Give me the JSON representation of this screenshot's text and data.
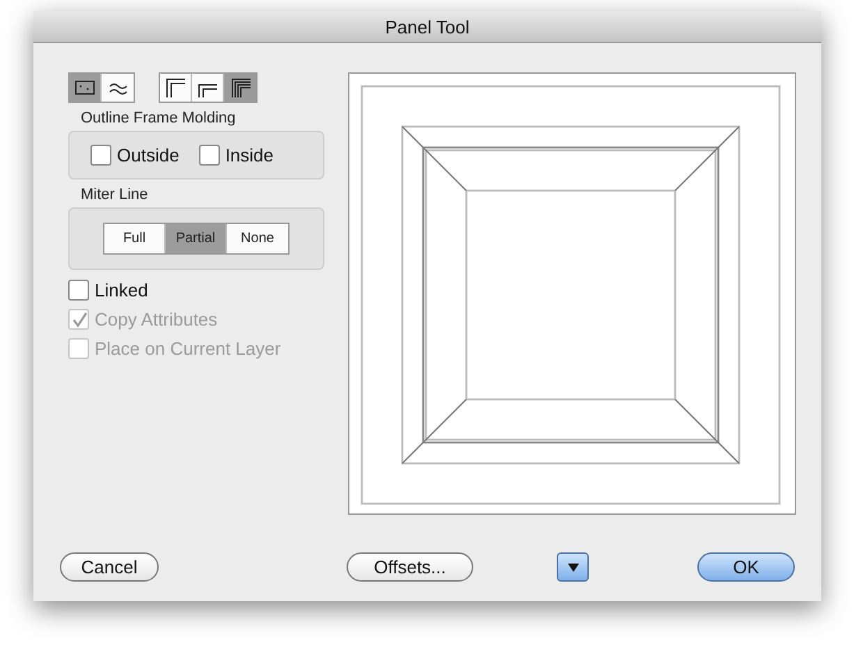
{
  "window": {
    "title": "Panel Tool"
  },
  "mode_buttons": [
    {
      "kind": "rectangle",
      "selected": true
    },
    {
      "kind": "wave",
      "selected": false
    }
  ],
  "corner_buttons": [
    {
      "kind": "wide",
      "selected": false
    },
    {
      "kind": "narrow",
      "selected": false
    },
    {
      "kind": "double",
      "selected": true
    }
  ],
  "outline_frame_molding": {
    "label": "Outline Frame Molding",
    "options": [
      {
        "label": "Outside",
        "checked": false
      },
      {
        "label": "Inside",
        "checked": false
      }
    ]
  },
  "miter_line": {
    "label": "Miter Line",
    "segments": [
      {
        "label": "Full",
        "selected": false
      },
      {
        "label": "Partial",
        "selected": true
      },
      {
        "label": "None",
        "selected": false
      }
    ]
  },
  "options": [
    {
      "label": "Linked",
      "checked": false,
      "disabled": false
    },
    {
      "label": "Copy Attributes",
      "checked": true,
      "disabled": true
    },
    {
      "label": "Place on Current Layer",
      "checked": false,
      "disabled": true
    }
  ],
  "footer_buttons": [
    {
      "kind": "push",
      "label": "Cancel",
      "default": false
    },
    {
      "kind": "push",
      "label": "Offsets...",
      "default": false
    },
    {
      "kind": "disclosure"
    },
    {
      "kind": "push",
      "label": "OK",
      "default": true
    }
  ]
}
